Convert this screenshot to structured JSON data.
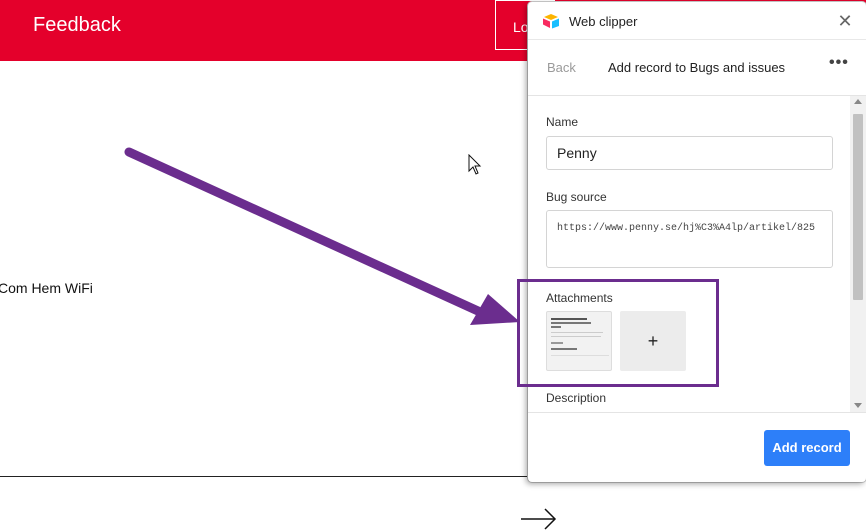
{
  "site": {
    "header_title": "Feedback",
    "login_label": "Lo",
    "body_text": "Com Hem WiFi",
    "colors": {
      "brand": "#e4002b"
    }
  },
  "clipper": {
    "title": "Web clipper",
    "close_icon": "close-icon",
    "back_label": "Back",
    "nav_title": "Add record to Bugs and issues",
    "more_label": "•••",
    "fields": {
      "name_label": "Name",
      "name_value": "Penny",
      "bug_source_label": "Bug source",
      "bug_source_value": "https://www.penny.se/hj%C3%A4lp/artikel/825",
      "attachments_label": "Attachments",
      "add_attachment_label": "+",
      "description_label": "Description"
    },
    "submit_label": "Add record",
    "colors": {
      "accent": "#2d7ff9",
      "annotation": "#6b2d8e"
    }
  }
}
